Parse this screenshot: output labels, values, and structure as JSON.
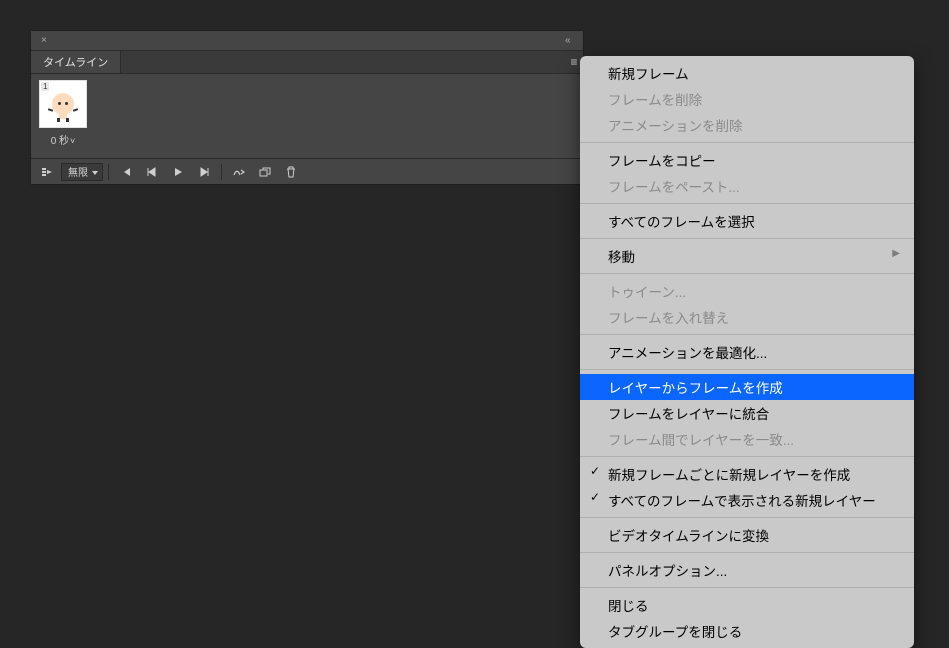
{
  "panel": {
    "tab_label": "タイムライン"
  },
  "frame": {
    "number": "1",
    "duration": "0 秒"
  },
  "toolbar": {
    "loop_label": "無限"
  },
  "menu": {
    "items": [
      {
        "label": "新規フレーム",
        "state": "enabled"
      },
      {
        "label": "フレームを削除",
        "state": "disabled"
      },
      {
        "label": "アニメーションを削除",
        "state": "disabled"
      },
      {
        "type": "sep"
      },
      {
        "label": "フレームをコピー",
        "state": "enabled"
      },
      {
        "label": "フレームをペースト...",
        "state": "disabled"
      },
      {
        "type": "sep"
      },
      {
        "label": "すべてのフレームを選択",
        "state": "enabled"
      },
      {
        "type": "sep"
      },
      {
        "label": "移動",
        "state": "enabled",
        "submenu": true
      },
      {
        "type": "sep"
      },
      {
        "label": "トゥイーン...",
        "state": "disabled"
      },
      {
        "label": "フレームを入れ替え",
        "state": "disabled"
      },
      {
        "type": "sep"
      },
      {
        "label": "アニメーションを最適化...",
        "state": "enabled"
      },
      {
        "type": "sep"
      },
      {
        "label": "レイヤーからフレームを作成",
        "state": "enabled",
        "highlight": true
      },
      {
        "label": "フレームをレイヤーに統合",
        "state": "enabled"
      },
      {
        "label": "フレーム間でレイヤーを一致...",
        "state": "disabled"
      },
      {
        "type": "sep"
      },
      {
        "label": "新規フレームごとに新規レイヤーを作成",
        "state": "enabled",
        "checked": true
      },
      {
        "label": "すべてのフレームで表示される新規レイヤー",
        "state": "enabled",
        "checked": true
      },
      {
        "type": "sep"
      },
      {
        "label": "ビデオタイムラインに変換",
        "state": "enabled"
      },
      {
        "type": "sep"
      },
      {
        "label": "パネルオプション...",
        "state": "enabled"
      },
      {
        "type": "sep"
      },
      {
        "label": "閉じる",
        "state": "enabled"
      },
      {
        "label": "タブグループを閉じる",
        "state": "enabled"
      }
    ]
  }
}
